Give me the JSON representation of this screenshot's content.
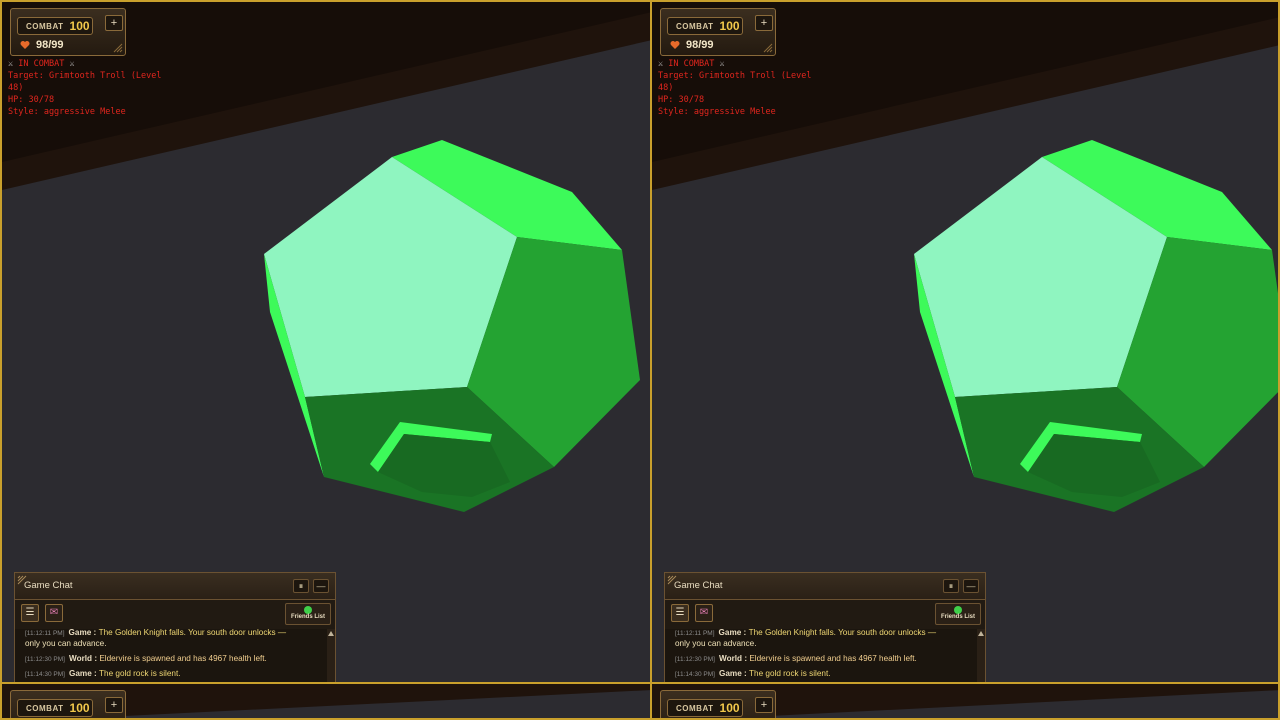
{
  "colors": {
    "gold_border": "#c9a02c",
    "gem_light": "#8ff5c0",
    "gem_bright": "#3dfa5a",
    "gem_dark": "#1a7425",
    "combat_text": "#e0261e"
  },
  "combat_widget": {
    "label": "COMBAT",
    "level": "100",
    "plus": "+",
    "hp": "98/99"
  },
  "combat_info": {
    "status": "IN COMBAT",
    "target_line1": "Target: Grimtooth Troll (Level",
    "target_line2": "48)",
    "hp": "HP: 30/78",
    "style": "Style: aggressive Melee"
  },
  "chat": {
    "title": "Game Chat",
    "pause_icon": "pause-icon",
    "minimize": "—",
    "tabs": [
      {
        "icon": "list-icon",
        "active": true
      },
      {
        "icon": "mail-icon",
        "active": false
      }
    ],
    "friends_label": "Friends List",
    "messages": [
      {
        "time": "[11:12:11 PM]",
        "channel": "Game",
        "text": "The Golden Knight falls. Your south door unlocks —",
        "text_cont": "only you can advance."
      },
      {
        "time": "[11:12:30 PM]",
        "channel": "World",
        "text": "Eldervire is spawned and has 4967 health left."
      },
      {
        "time": "[11:14:30 PM]",
        "channel": "Game",
        "text": "The gold rock is silent."
      }
    ]
  }
}
